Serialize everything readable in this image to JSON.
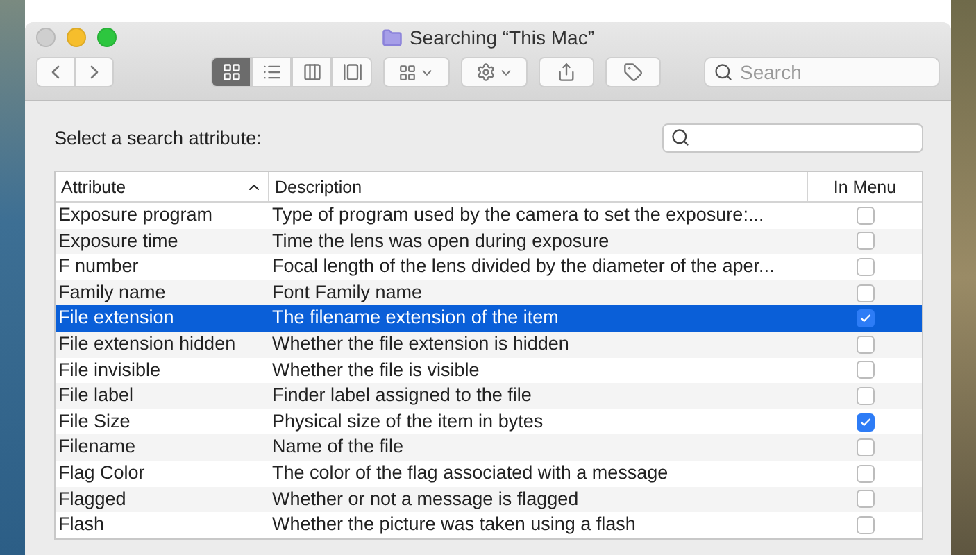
{
  "window": {
    "title": "Searching “This Mac”"
  },
  "toolbar": {
    "view_modes": [
      {
        "kind": "icons",
        "selected": true
      },
      {
        "kind": "list",
        "selected": false
      },
      {
        "kind": "columns",
        "selected": false
      },
      {
        "kind": "gallery",
        "selected": false
      }
    ],
    "search": {
      "placeholder": "Search"
    }
  },
  "dialog": {
    "prompt": "Select a search attribute:"
  },
  "table": {
    "columns": [
      {
        "label": "Attribute",
        "sorted": true
      },
      {
        "label": "Description",
        "sorted": false
      },
      {
        "label": "In Menu",
        "sorted": false
      }
    ],
    "rows": [
      {
        "attribute": "Exposure program",
        "description": "Type of program used by the camera to set the exposure:...",
        "in_menu": false,
        "selected": false
      },
      {
        "attribute": "Exposure time",
        "description": "Time the lens was open during exposure",
        "in_menu": false,
        "selected": false
      },
      {
        "attribute": "F number",
        "description": "Focal length of the lens divided by the diameter of the aper...",
        "in_menu": false,
        "selected": false
      },
      {
        "attribute": "Family name",
        "description": "Font Family name",
        "in_menu": false,
        "selected": false
      },
      {
        "attribute": "File extension",
        "description": "The filename extension of the item",
        "in_menu": true,
        "selected": true
      },
      {
        "attribute": "File extension hidden",
        "description": "Whether the file extension is hidden",
        "in_menu": false,
        "selected": false
      },
      {
        "attribute": "File invisible",
        "description": "Whether the file is visible",
        "in_menu": false,
        "selected": false
      },
      {
        "attribute": "File label",
        "description": "Finder label assigned to the file",
        "in_menu": false,
        "selected": false
      },
      {
        "attribute": "File Size",
        "description": "Physical size of the item in bytes",
        "in_menu": true,
        "selected": false
      },
      {
        "attribute": "Filename",
        "description": "Name of the file",
        "in_menu": false,
        "selected": false
      },
      {
        "attribute": "Flag Color",
        "description": "The color of the flag associated with a message",
        "in_menu": false,
        "selected": false
      },
      {
        "attribute": "Flagged",
        "description": "Whether or not a message is flagged",
        "in_menu": false,
        "selected": false
      },
      {
        "attribute": "Flash",
        "description": "Whether the picture was taken using a flash",
        "in_menu": false,
        "selected": false
      }
    ]
  }
}
